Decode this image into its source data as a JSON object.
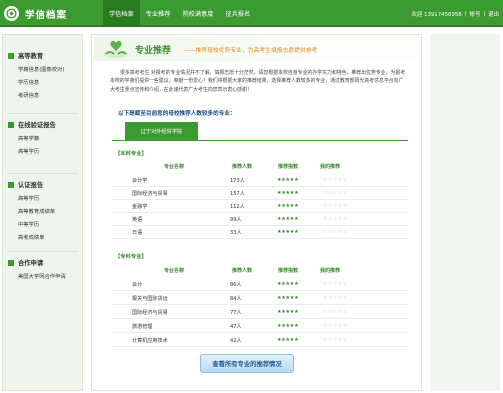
{
  "header": {
    "logo_text": "学信档案",
    "nav": [
      {
        "label": "学信档案",
        "active": true
      },
      {
        "label": "专业推荐",
        "active": false
      },
      {
        "label": "院校满意度",
        "active": false
      },
      {
        "label": "征兵报名",
        "active": false
      }
    ],
    "user": {
      "welcome": "欢迎 13917456958",
      "account": "帐号",
      "logout": "退出"
    }
  },
  "sidebar": {
    "sections": [
      {
        "title": "高等教育",
        "items": [
          "学籍信息(图像校对)",
          "学历信息",
          "考研信息"
        ]
      },
      {
        "title": "在线验证报告",
        "items": [
          "高等学籍",
          "高等学历"
        ]
      },
      {
        "title": "认证报告",
        "items": [
          "高等学历",
          "高等教育成绩单",
          "中等学历",
          "高考成绩单"
        ]
      },
      {
        "title": "合作申请",
        "items": [
          "美国大学网合作申请"
        ]
      }
    ]
  },
  "main": {
    "banner_title": "专业推荐",
    "banner_subtitle": "——推荐母校优势专业，为高考生填报志愿提供参考",
    "intro": "很多高考考生 对报考的专业情况并不了解，填报志愿十分茫然，请您根据本校自身专业的办学实力和特色，推荐出优势专业，为报考本校的学弟们提供一些建议，奉献一份爱心！我们将根据大家的推荐结果，选择推荐人数较多的专业，通过教育部阳光高考信息平台向广大考生重点宣传和介绍，在此谨代表广大考生向您表示衷心感谢！",
    "reco_title": "以下是截至目前您的母校推荐人数较多的专业：",
    "tab_label": "辽宁对外经贸学院",
    "columns": {
      "name": "专业名称",
      "count": "推荐人数",
      "index": "推荐指数",
      "mine": "我的推荐"
    },
    "groups": [
      {
        "label": "【本科专业】",
        "rows": [
          {
            "name": "会计学",
            "count": "173人",
            "index": "★★★★★",
            "mine": "☆☆☆☆☆"
          },
          {
            "name": "国际经济与贸易",
            "count": "157人",
            "index": "★★★★★",
            "mine": "☆☆☆☆☆"
          },
          {
            "name": "金融学",
            "count": "112人",
            "index": "★★★★★",
            "mine": "☆☆☆☆☆"
          },
          {
            "name": "英语",
            "count": "99人",
            "index": "★★★★★",
            "mine": "☆☆☆☆☆"
          },
          {
            "name": "日语",
            "count": "33人",
            "index": "★★★★★",
            "mine": "☆☆☆☆☆"
          }
        ]
      },
      {
        "label": "【专科专业】",
        "rows": [
          {
            "name": "会计",
            "count": "86人",
            "index": "★★★★★",
            "mine": "☆☆☆☆☆"
          },
          {
            "name": "报关与国际货运",
            "count": "84人",
            "index": "★★★★★",
            "mine": "☆☆☆☆☆"
          },
          {
            "name": "国际经济与贸易",
            "count": "77人",
            "index": "★★★★★",
            "mine": "☆☆☆☆☆"
          },
          {
            "name": "旅游管理",
            "count": "47人",
            "index": "★★★★★",
            "mine": "☆☆☆☆☆"
          },
          {
            "name": "计算机应用技术",
            "count": "42人",
            "index": "★★★★★",
            "mine": "☆☆☆☆☆"
          }
        ]
      }
    ],
    "view_all_label": "查看所有专业的推荐情况"
  },
  "colors": {
    "brand_green": "#3b9a30",
    "orange_text": "#e38b1a",
    "blue_text": "#1d4f8a"
  },
  "icons": {
    "logo": "seal-logo-icon",
    "banner": "heart-hands-icon",
    "section_bullet": "square-bullet-icon"
  }
}
